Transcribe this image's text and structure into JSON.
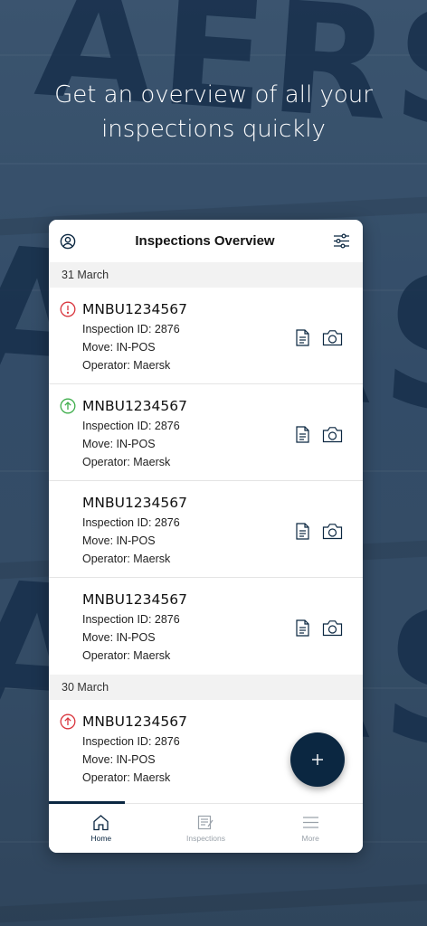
{
  "headline": {
    "line1": "Get an overview of all your",
    "line2": "inspections quickly"
  },
  "background": {
    "wall_text_top": "AERSK",
    "wall_text_mid": "AERS",
    "wall_text_low": "AERS"
  },
  "app": {
    "title": "Inspections Overview",
    "left_icon": "user-circle-icon",
    "right_icon": "filter-sliders-icon"
  },
  "sections": [
    {
      "date": "31 March",
      "items": [
        {
          "container": "MNBU1234567",
          "inspection_id": "Inspection ID: 2876",
          "move": "Move: IN-POS",
          "operator": "Operator: Maersk",
          "status_icon": "alert-circle-icon",
          "status_color": "#d9363e"
        },
        {
          "container": "MNBU1234567",
          "inspection_id": "Inspection ID: 2876",
          "move": "Move: IN-POS",
          "operator": "Operator: Maersk",
          "status_icon": "arrow-up-circle-icon",
          "status_color": "#3fae4c"
        },
        {
          "container": "MNBU1234567",
          "inspection_id": "Inspection ID: 2876",
          "move": "Move: IN-POS",
          "operator": "Operator: Maersk",
          "status_icon": "",
          "status_color": ""
        },
        {
          "container": "MNBU1234567",
          "inspection_id": "Inspection ID: 2876",
          "move": "Move: IN-POS",
          "operator": "Operator: Maersk",
          "status_icon": "",
          "status_color": ""
        }
      ]
    },
    {
      "date": "30 March",
      "items": [
        {
          "container": "MNBU1234567",
          "inspection_id": "Inspection ID: 2876",
          "move": "Move: IN-POS",
          "operator": "Operator: Maersk",
          "status_icon": "arrow-up-circle-icon",
          "status_color": "#d9363e"
        }
      ]
    }
  ],
  "fab": {
    "icon": "plus-icon",
    "label": "+"
  },
  "bottom_nav": [
    {
      "label": "Home",
      "icon": "home-icon",
      "active": true
    },
    {
      "label": "Inspections",
      "icon": "inspections-icon",
      "active": false
    },
    {
      "label": "More",
      "icon": "menu-icon",
      "active": false
    }
  ],
  "colors": {
    "accent": "#0b2741",
    "alert": "#d9363e",
    "success": "#3fae4c"
  }
}
